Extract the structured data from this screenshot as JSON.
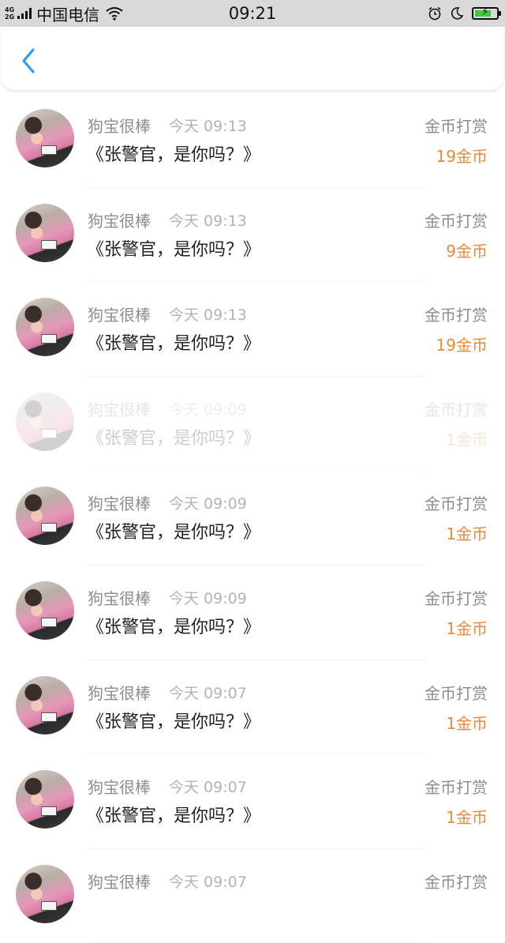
{
  "status_bar": {
    "network_top": "4G",
    "network_bottom": "2G",
    "carrier": "中国电信",
    "time": "09:21",
    "battery_level": 0.75,
    "battery_color": "#3fc83f",
    "icons": [
      "signal-icon",
      "wifi-icon",
      "alarm-icon",
      "moon-icon",
      "battery-charging-icon"
    ]
  },
  "nav": {
    "back_icon": "chevron-left-icon",
    "back_color": "#2e9bf0"
  },
  "colors": {
    "amount": "#e98a38",
    "muted": "#8d8d8d"
  },
  "items": [
    {
      "username": "狗宝很棒",
      "time": "今天 09:13",
      "title": "《张警官，是你吗？》",
      "type": "金币打赏",
      "amount": "19金币"
    },
    {
      "username": "狗宝很棒",
      "time": "今天 09:13",
      "title": "《张警官，是你吗？》",
      "type": "金币打赏",
      "amount": "9金币"
    },
    {
      "username": "狗宝很棒",
      "time": "今天 09:13",
      "title": "《张警官，是你吗？》",
      "type": "金币打赏",
      "amount": "19金币"
    },
    {
      "username": "狗宝很棒",
      "time": "今天 09:09",
      "title": "《张警官，是你吗？》",
      "type": "金币打赏",
      "amount": "1金币"
    },
    {
      "username": "狗宝很棒",
      "time": "今天 09:09",
      "title": "《张警官，是你吗？》",
      "type": "金币打赏",
      "amount": "1金币"
    },
    {
      "username": "狗宝很棒",
      "time": "今天 09:09",
      "title": "《张警官，是你吗？》",
      "type": "金币打赏",
      "amount": "1金币"
    },
    {
      "username": "狗宝很棒",
      "time": "今天 09:07",
      "title": "《张警官，是你吗？》",
      "type": "金币打赏",
      "amount": "1金币"
    },
    {
      "username": "狗宝很棒",
      "time": "今天 09:07",
      "title": "《张警官，是你吗？》",
      "type": "金币打赏",
      "amount": "1金币"
    },
    {
      "username": "狗宝很棒",
      "time": "今天 09:07",
      "title": "",
      "type": "金币打赏",
      "amount": ""
    }
  ]
}
